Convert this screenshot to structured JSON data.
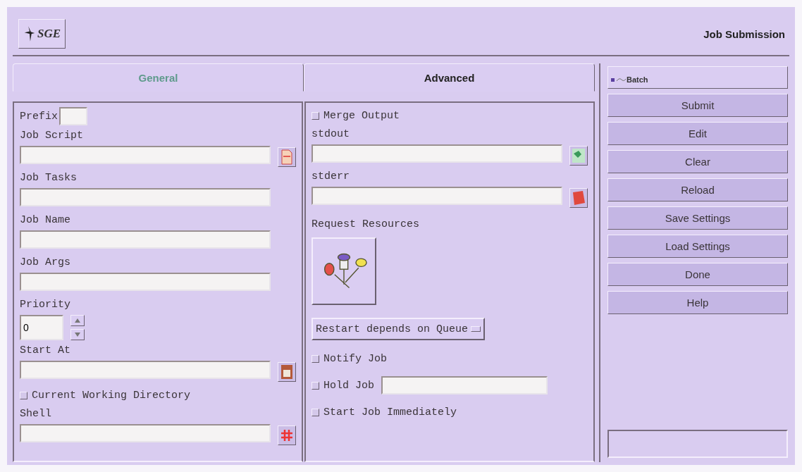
{
  "header": {
    "logo": "SGE",
    "title": "Job Submission"
  },
  "tabs": [
    {
      "label": "General",
      "selected": true
    },
    {
      "label": "Advanced",
      "selected": false
    }
  ],
  "general": [
    {
      "kind": "prefix",
      "label": "Prefix"
    },
    {
      "kind": "file",
      "label": "Job Script"
    },
    {
      "kind": "plain",
      "label": "Job Tasks"
    },
    {
      "kind": "plain",
      "label": "Job Name"
    },
    {
      "kind": "plain",
      "label": "Job Args"
    },
    {
      "kind": "spinner",
      "label": "Priority",
      "value": "0"
    },
    {
      "kind": "date",
      "label": "Start At"
    },
    {
      "kind": "checkbox",
      "label": "Current Working Directory",
      "checked": false
    },
    {
      "kind": "shell",
      "label": "Shell"
    }
  ],
  "advanced": [
    {
      "kind": "checkbox",
      "label": "Merge Output",
      "checked": false
    },
    {
      "kind": "stdout",
      "label": "stdout"
    },
    {
      "kind": "stderr",
      "label": "stderr"
    },
    {
      "kind": "resources",
      "label": "Request Resources"
    },
    {
      "kind": "menu",
      "label": "Restart depends on Queue"
    },
    {
      "kind": "checkbox",
      "label": "Notify Job",
      "checked": false
    },
    {
      "kind": "checkfield",
      "label": "Hold Job",
      "checked": false
    },
    {
      "kind": "checkbox",
      "label": "Start Job Immediately",
      "checked": false
    }
  ],
  "side": {
    "mode": {
      "label": "Batch"
    },
    "buttons": [
      "Submit",
      "Edit",
      "Clear",
      "Reload",
      "Save Settings",
      "Load Settings",
      "Done",
      "Help"
    ]
  }
}
